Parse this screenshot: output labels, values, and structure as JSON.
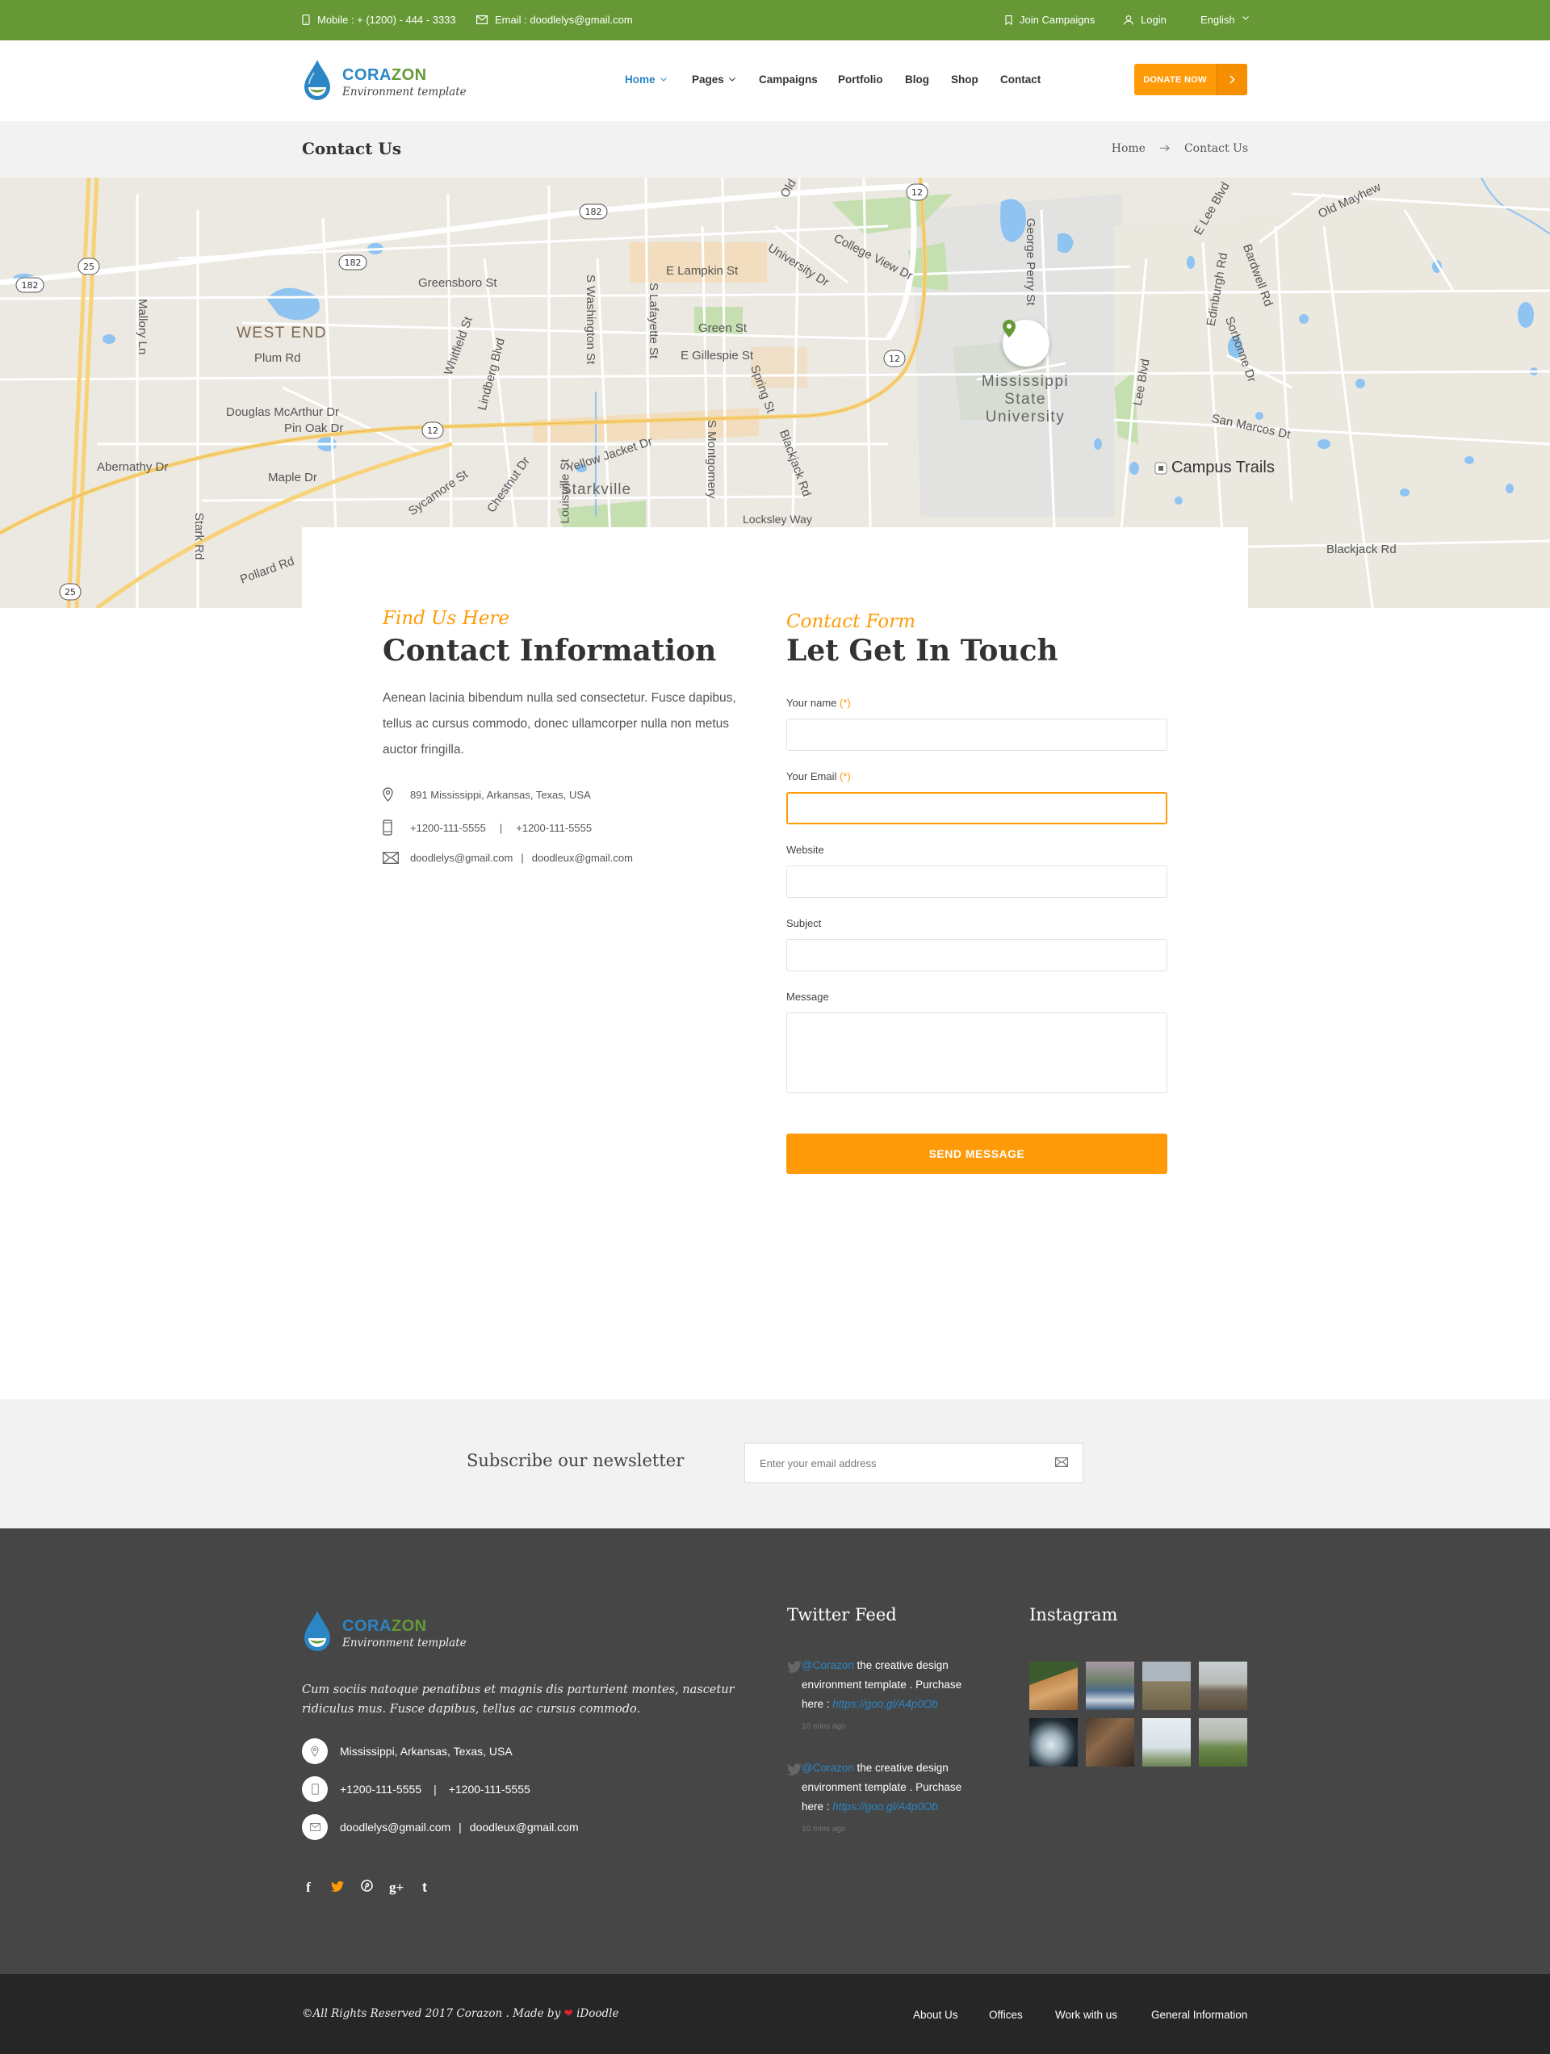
{
  "topbar": {
    "mobile": "Mobile : + (1200) - 444 - 3333",
    "email": "Email : doodlelys@gmail.com",
    "join": "Join Campaigns",
    "login": "Login",
    "language": "English"
  },
  "header": {
    "logo_a": "CORA",
    "logo_b": "ZON",
    "logo_tagline": "Environment template",
    "nav": [
      "Home",
      "Pages",
      "Campaigns",
      "Portfolio",
      "Blog",
      "Shop",
      "Contact"
    ],
    "donate": "DONATE NOW"
  },
  "title": {
    "page": "Contact Us",
    "crumb_home": "Home",
    "crumb_current": "Contact Us"
  },
  "map": {
    "labels": [
      "WEST END",
      "Greensboro St",
      "E Lampkin St",
      "Green St",
      "E Gillespie St",
      "College View Dr",
      "University Dr",
      "Plum Rd",
      "Douglas McArthur Dr",
      "Pin Oak Dr",
      "Abernathy Dr",
      "Maple Dr",
      "Whitfield St",
      "Lindberg Blvd",
      "S Washington St",
      "S Lafayette St",
      "Spring St",
      "Sycamore St",
      "Chestnut Dr",
      "Louisville St",
      "Yellow Jacket Dr",
      "Starkville",
      "S Montgomery",
      "Blackjack Rd",
      "Locksley Way",
      "Mississippi State University",
      "Lee Blvd",
      "George Perry St",
      "E Lee Blvd",
      "Edinburgh Rd",
      "Sorbonne Dr",
      "Bardwell Rd",
      "Old Mayhew",
      "San Marcos Dt",
      "Campus Trails",
      "Blackjack Rd",
      "Mallory Ln",
      "Stark Rd",
      "Pollard Rd",
      "Old"
    ],
    "shields": [
      "182",
      "182",
      "182",
      "25",
      "25",
      "12",
      "12",
      "12"
    ]
  },
  "contact": {
    "eyebrow": "Find Us Here",
    "heading": "Contact Information",
    "description": "Aenean lacinia bibendum nulla sed consectetur. Fusce dapibus, tellus ac cursus commodo, donec ullamcorper nulla non metus auctor fringilla.",
    "address": "891 Mississippi, Arkansas, Texas, USA",
    "phone1": "+1200-111-5555",
    "phone2": "+1200-111-5555",
    "email1": "doodlelys@gmail.com",
    "email2": "doodleux@gmail.com",
    "sep": "|"
  },
  "form": {
    "eyebrow": "Contact Form",
    "heading": "Let Get In Touch",
    "name_label": "Your name",
    "email_label": "Your Email",
    "required_mark": "(*)",
    "website_label": "Website",
    "subject_label": "Subject",
    "message_label": "Message",
    "name_value": "",
    "email_value": "",
    "website_value": "",
    "subject_value": "",
    "message_value": "",
    "submit": "SEND MESSAGE"
  },
  "newsletter": {
    "label": "Subscribe our newsletter",
    "placeholder": "Enter your email address"
  },
  "footer": {
    "description": "Cum sociis natoque penatibus et magnis dis parturient montes, nascetur ridiculus mus. Fusce dapibus, tellus ac cursus commodo.",
    "address": "Mississippi, Arkansas, Texas, USA",
    "phone1": "+1200-111-5555",
    "phone2": "+1200-111-5555",
    "email1": "doodlelys@gmail.com",
    "email2": "doodleux@gmail.com",
    "sep": "|",
    "social": [
      "f",
      "t",
      "p",
      "g+",
      "t"
    ],
    "twitter_heading": "Twitter Feed",
    "tweets": [
      {
        "handle": "@Corazon",
        "text": " the creative design environment template . Purchase here : ",
        "url": "https://goo.gl/A4p0Ob",
        "time": "10 mins ago"
      },
      {
        "handle": "@Corazon",
        "text": " the creative design environment template . Purchase here : ",
        "url": "https://goo.gl/A4p0Ob",
        "time": "10 mins ago"
      }
    ],
    "instagram_heading": "Instagram"
  },
  "bottom": {
    "copyright_a": "©All Rights Reserved 2017 Corazon . Made by ",
    "copyright_b": " iDoodle",
    "links": [
      "About Us",
      "Offices",
      "Work with us",
      "General Information"
    ]
  },
  "colors": {
    "brand_green": "#669936",
    "brand_blue": "#2b86c5",
    "accent_orange": "#ff9a09",
    "footer_bg": "#464646",
    "bottom_bg": "#262626"
  }
}
